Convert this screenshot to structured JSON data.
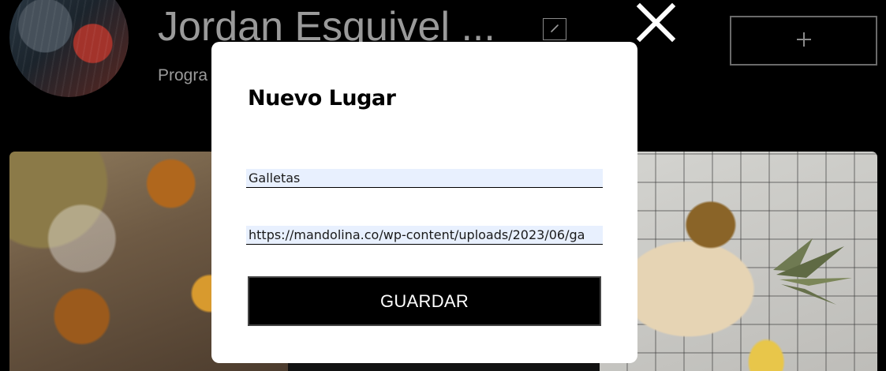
{
  "profile": {
    "name": "Jordan Esquivel ...",
    "role": "Progra"
  },
  "modal": {
    "title": "Nuevo Lugar",
    "name_value": "Galletas",
    "url_value": "https://mandolina.co/wp-content/uploads/2023/06/ga",
    "save_label": "GUARDAR"
  },
  "icons": {
    "edit": "pencil-icon",
    "add": "plus-icon",
    "close": "close-icon"
  },
  "colors": {
    "background": "#000000",
    "modal": "#ffffff",
    "field_autofill": "#e8f0fe",
    "muted_text": "#9a9a9a",
    "save_button": "#000000"
  }
}
